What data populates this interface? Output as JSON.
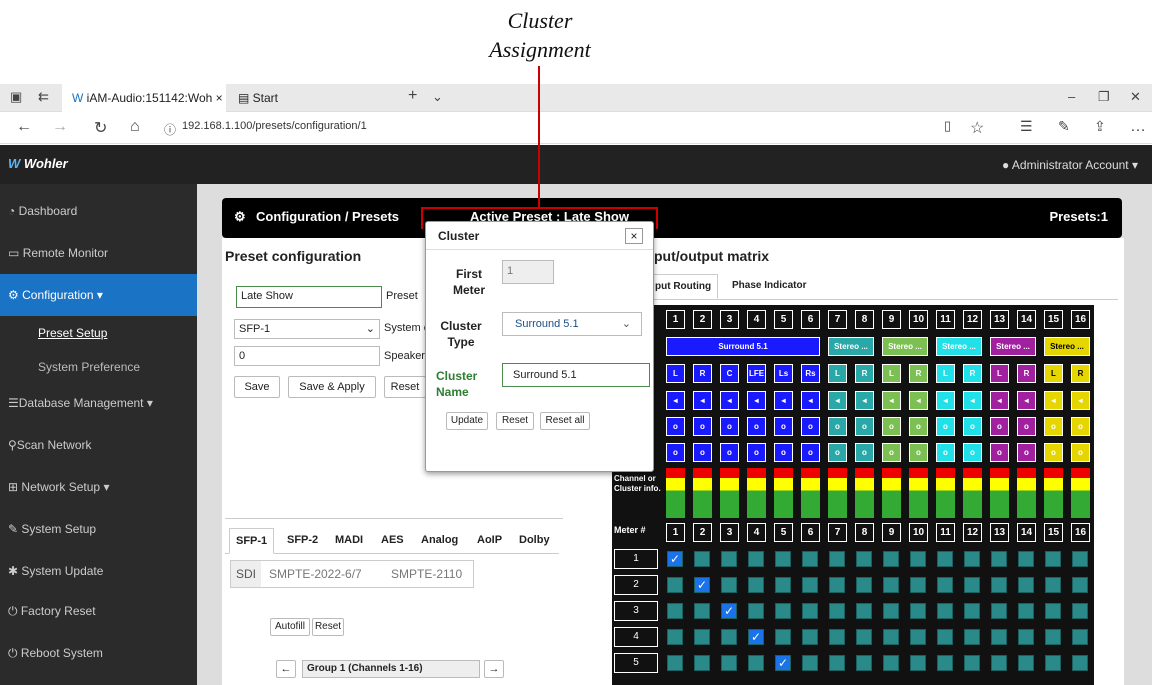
{
  "annotation": {
    "line1": "Cluster",
    "line2": "Assignment"
  },
  "browser": {
    "tab_title": "iAM-Audio:151142:Woh",
    "tab2_title": "Start",
    "url": "192.168.1.100/presets/configuration/1"
  },
  "app": {
    "logo": "Wohler",
    "account": "Administrator Account"
  },
  "sidebar": {
    "items": [
      "Dashboard",
      "Remote Monitor",
      "Configuration",
      "Preset Setup",
      "System Preference",
      "Database Management",
      "Scan Network",
      "Network Setup",
      "System Setup",
      "System Update",
      "Factory Reset",
      "Reboot System"
    ]
  },
  "header": {
    "title": "Configuration / Presets",
    "active_preset": "Active Preset : Late Show",
    "presets": "Presets:1"
  },
  "preset": {
    "heading": "Preset configuration",
    "name_value": "Late Show",
    "name_label": "Preset",
    "sfp_value": "SFP-1",
    "system_label": "System c",
    "speaker_value": "0",
    "speaker_label": "Speaker",
    "save": "Save",
    "save_apply": "Save & Apply",
    "reset": "Reset"
  },
  "io_tabs": [
    "SFP-1",
    "SFP-2",
    "MADI",
    "AES",
    "Analog",
    "AoIP",
    "Dolby"
  ],
  "std_tabs": [
    "SDI",
    "SMPTE-2022-6/7",
    "SMPTE-2110"
  ],
  "autofill": "Autofill",
  "reset2": "Reset",
  "group": "Group 1 (Channels 1-16)",
  "matrix": {
    "heading": "put/output matrix",
    "tabs": [
      "put Routing",
      "Phase Indicator"
    ],
    "meter_label": "Meter #",
    "channel_label": "Channel or Cluster info.",
    "clusters": [
      "Surround 5.1",
      "Stereo ...",
      "Stereo ...",
      "Stereo ...",
      "Stereo ...",
      "Stereo ..."
    ],
    "labels": [
      "L",
      "R",
      "C",
      "LFE",
      "Ls",
      "Rs",
      "L",
      "R",
      "L",
      "R",
      "L",
      "R",
      "L",
      "R",
      "L",
      "R"
    ],
    "rows": [
      "1",
      "2",
      "3",
      "4",
      "5"
    ]
  },
  "popup": {
    "title": "Cluster",
    "first_meter_label": "First Meter",
    "first_meter_value": "1",
    "type_label": "Cluster Type",
    "type_value": "Surround 5.1",
    "name_label": "Cluster Name",
    "name_value": "Surround 5.1",
    "update": "Update",
    "reset": "Reset",
    "reset_all": "Reset all",
    "close": "×"
  }
}
